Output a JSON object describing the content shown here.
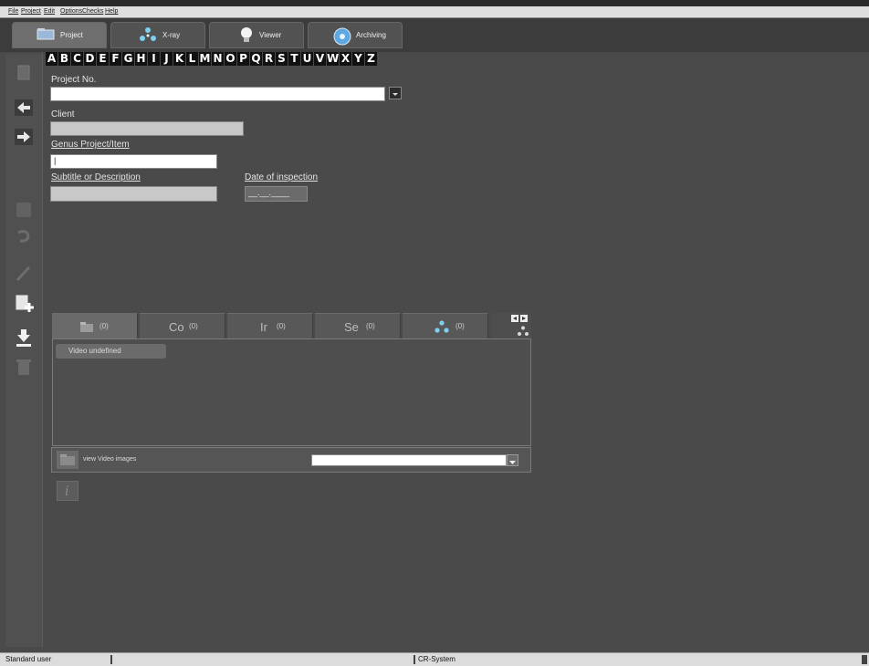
{
  "menu": [
    "File",
    "Project",
    "Edit",
    "Options",
    "Checks",
    "Help"
  ],
  "tabs": [
    {
      "label": "Project",
      "icon": "project-icon",
      "active": true
    },
    {
      "label": "X-ray",
      "icon": "radiation-icon",
      "active": false
    },
    {
      "label": "Viewer",
      "icon": "lightbulb-icon",
      "active": false
    },
    {
      "label": "Archiving",
      "icon": "archive-disc-icon",
      "active": false
    }
  ],
  "alphabet": [
    "A",
    "B",
    "C",
    "D",
    "E",
    "F",
    "G",
    "H",
    "I",
    "J",
    "K",
    "L",
    "M",
    "N",
    "O",
    "P",
    "Q",
    "R",
    "S",
    "T",
    "U",
    "V",
    "W",
    "X",
    "Y",
    "Z"
  ],
  "toolbar": [
    "document-icon",
    "back-arrow-icon",
    "forward-arrow-icon",
    "save-icon",
    "undo-icon",
    "edit-pencil-icon",
    "add-item-icon",
    "download-icon",
    "delete-icon"
  ],
  "form": {
    "project_no_label": "Project No.",
    "project_no_value": "",
    "client_label": "Client",
    "client_value": "",
    "genus_label": "Genus Project/Item",
    "genus_value": "|",
    "subtitle_label": "Subtitle or Description",
    "subtitle_value": "",
    "date_label": "Date of inspection",
    "date_value": "__.__.____"
  },
  "subtabs": [
    {
      "label": "",
      "count": "(0)",
      "icon": "video-folder-icon"
    },
    {
      "label": "Co",
      "count": "(0)",
      "icon": ""
    },
    {
      "label": "Ir",
      "count": "(0)",
      "icon": ""
    },
    {
      "label": "Se",
      "count": "(0)",
      "icon": ""
    },
    {
      "label": "",
      "count": "(0)",
      "icon": "radiation-icon"
    }
  ],
  "video": {
    "undefined_label": "Video undefined",
    "view_images_label": "view Video images",
    "select_value": ""
  },
  "status": {
    "user": "Standard user",
    "system": "CR-System"
  },
  "colors": {
    "accent_white": "#ffffff",
    "background": "#4a4a4a",
    "letter_bg": "#111111"
  }
}
